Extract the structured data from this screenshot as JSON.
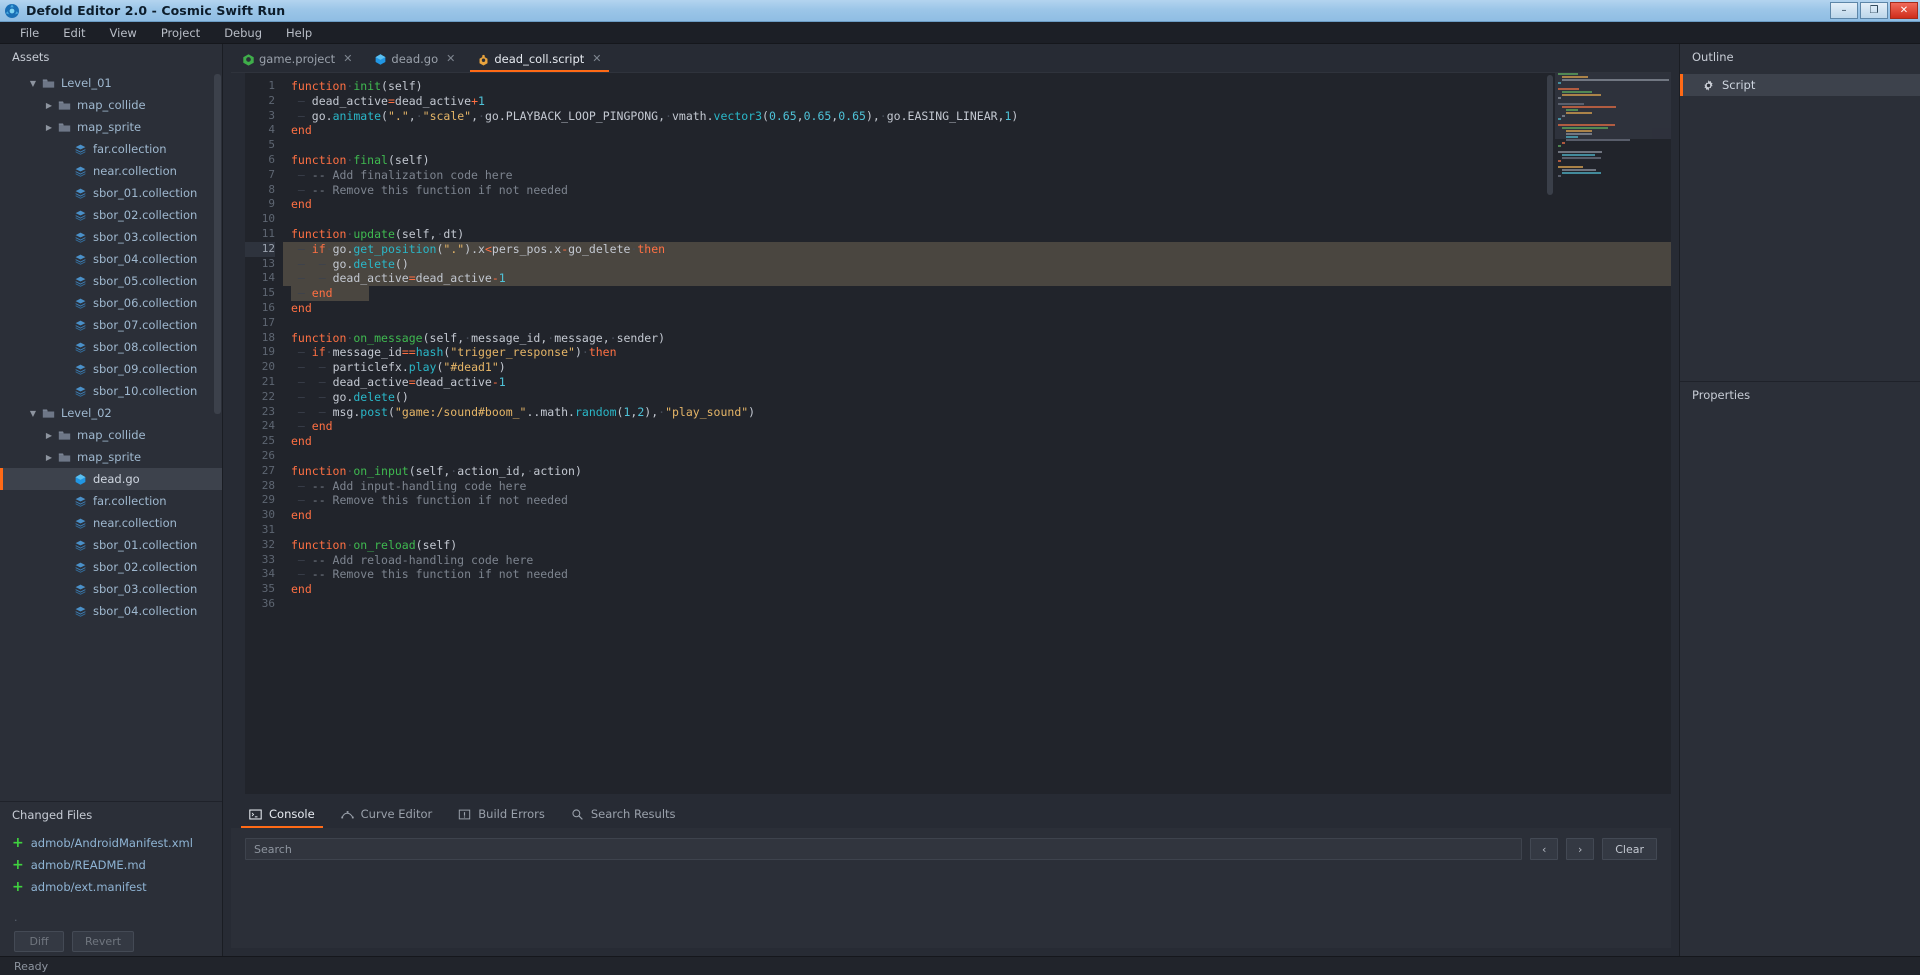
{
  "window": {
    "title": "Defold Editor 2.0 - Cosmic Swift Run",
    "app_icon": "defold-logo-icon",
    "minimize": "–",
    "maximize": "❐",
    "close": "✕"
  },
  "menubar": {
    "items": [
      "File",
      "Edit",
      "View",
      "Project",
      "Debug",
      "Help"
    ]
  },
  "assets": {
    "title": "Assets",
    "tree": [
      {
        "label": "Level_01",
        "depth": 1,
        "twisty": "▼",
        "icon": "folder-icon"
      },
      {
        "label": "map_collide",
        "depth": 2,
        "twisty": "▶",
        "icon": "folder-icon"
      },
      {
        "label": "map_sprite",
        "depth": 2,
        "twisty": "▶",
        "icon": "folder-icon"
      },
      {
        "label": "far.collection",
        "depth": 3,
        "twisty": "",
        "icon": "collection-icon"
      },
      {
        "label": "near.collection",
        "depth": 3,
        "twisty": "",
        "icon": "collection-icon"
      },
      {
        "label": "sbor_01.collection",
        "depth": 3,
        "twisty": "",
        "icon": "collection-icon"
      },
      {
        "label": "sbor_02.collection",
        "depth": 3,
        "twisty": "",
        "icon": "collection-icon"
      },
      {
        "label": "sbor_03.collection",
        "depth": 3,
        "twisty": "",
        "icon": "collection-icon"
      },
      {
        "label": "sbor_04.collection",
        "depth": 3,
        "twisty": "",
        "icon": "collection-icon"
      },
      {
        "label": "sbor_05.collection",
        "depth": 3,
        "twisty": "",
        "icon": "collection-icon"
      },
      {
        "label": "sbor_06.collection",
        "depth": 3,
        "twisty": "",
        "icon": "collection-icon"
      },
      {
        "label": "sbor_07.collection",
        "depth": 3,
        "twisty": "",
        "icon": "collection-icon"
      },
      {
        "label": "sbor_08.collection",
        "depth": 3,
        "twisty": "",
        "icon": "collection-icon"
      },
      {
        "label": "sbor_09.collection",
        "depth": 3,
        "twisty": "",
        "icon": "collection-icon"
      },
      {
        "label": "sbor_10.collection",
        "depth": 3,
        "twisty": "",
        "icon": "collection-icon"
      },
      {
        "label": "Level_02",
        "depth": 1,
        "twisty": "▼",
        "icon": "folder-icon"
      },
      {
        "label": "map_collide",
        "depth": 2,
        "twisty": "▶",
        "icon": "folder-icon"
      },
      {
        "label": "map_sprite",
        "depth": 2,
        "twisty": "▶",
        "icon": "folder-icon"
      },
      {
        "label": "dead.go",
        "depth": 3,
        "twisty": "",
        "icon": "gameobject-icon",
        "selected": true
      },
      {
        "label": "far.collection",
        "depth": 3,
        "twisty": "",
        "icon": "collection-icon"
      },
      {
        "label": "near.collection",
        "depth": 3,
        "twisty": "",
        "icon": "collection-icon"
      },
      {
        "label": "sbor_01.collection",
        "depth": 3,
        "twisty": "",
        "icon": "collection-icon"
      },
      {
        "label": "sbor_02.collection",
        "depth": 3,
        "twisty": "",
        "icon": "collection-icon"
      },
      {
        "label": "sbor_03.collection",
        "depth": 3,
        "twisty": "",
        "icon": "collection-icon"
      },
      {
        "label": "sbor_04.collection",
        "depth": 3,
        "twisty": "",
        "icon": "collection-icon"
      }
    ]
  },
  "changed_files": {
    "title": "Changed Files",
    "items": [
      {
        "status": "+",
        "path": "admob/AndroidManifest.xml"
      },
      {
        "status": "+",
        "path": "admob/README.md"
      },
      {
        "status": "+",
        "path": "admob/ext.manifest"
      }
    ],
    "more_indicator": "·",
    "diff_label": "Diff",
    "revert_label": "Revert"
  },
  "editor_tabs": [
    {
      "label": "game.project",
      "icon": "project-icon",
      "close": "✕",
      "active": false
    },
    {
      "label": "dead.go",
      "icon": "gameobject-icon",
      "close": "✕",
      "active": false
    },
    {
      "label": "dead_coll.script",
      "icon": "script-icon",
      "close": "✕",
      "active": true
    }
  ],
  "editor": {
    "first_line": 1,
    "last_line": 36,
    "cursor_line": 12,
    "selection_start_line": 12,
    "selection_end_line": 15,
    "lines": [
      {
        "n": 1,
        "t": "function init(self)"
      },
      {
        "n": 2,
        "t": "    dead_active=dead_active+1"
      },
      {
        "n": 3,
        "t": "    go.animate(\".\", \"scale\", go.PLAYBACK_LOOP_PINGPONG, vmath.vector3(0.65,0.65,0.65), go.EASING_LINEAR,1)"
      },
      {
        "n": 4,
        "t": "end"
      },
      {
        "n": 5,
        "t": ""
      },
      {
        "n": 6,
        "t": "function final(self)"
      },
      {
        "n": 7,
        "t": "    -- Add finalization code here"
      },
      {
        "n": 8,
        "t": "    -- Remove this function if not needed"
      },
      {
        "n": 9,
        "t": "end"
      },
      {
        "n": 10,
        "t": ""
      },
      {
        "n": 11,
        "t": "function update(self, dt)"
      },
      {
        "n": 12,
        "t": "    if go.get_position(\".\").x<pers_pos.x-go_delete then"
      },
      {
        "n": 13,
        "t": "        go.delete()"
      },
      {
        "n": 14,
        "t": "        dead_active=dead_active-1"
      },
      {
        "n": 15,
        "t": "    end"
      },
      {
        "n": 16,
        "t": "end"
      },
      {
        "n": 17,
        "t": ""
      },
      {
        "n": 18,
        "t": "function on_message(self, message_id, message, sender)"
      },
      {
        "n": 19,
        "t": "    if message_id==hash(\"trigger_response\") then"
      },
      {
        "n": 20,
        "t": "        particlefx.play(\"#dead1\")"
      },
      {
        "n": 21,
        "t": "        dead_active=dead_active-1"
      },
      {
        "n": 22,
        "t": "        go.delete()"
      },
      {
        "n": 23,
        "t": "        msg.post(\"game:/sound#boom_\"..math.random(1,2), \"play_sound\")"
      },
      {
        "n": 24,
        "t": "    end"
      },
      {
        "n": 25,
        "t": "end"
      },
      {
        "n": 26,
        "t": ""
      },
      {
        "n": 27,
        "t": "function on_input(self, action_id, action)"
      },
      {
        "n": 28,
        "t": "    -- Add input-handling code here"
      },
      {
        "n": 29,
        "t": "    -- Remove this function if not needed"
      },
      {
        "n": 30,
        "t": "end"
      },
      {
        "n": 31,
        "t": ""
      },
      {
        "n": 32,
        "t": "function on_reload(self)"
      },
      {
        "n": 33,
        "t": "    -- Add reload-handling code here"
      },
      {
        "n": 34,
        "t": "    -- Remove this function if not needed"
      },
      {
        "n": 35,
        "t": "end"
      },
      {
        "n": 36,
        "t": ""
      }
    ]
  },
  "bottom_panel": {
    "tabs": [
      {
        "label": "Console",
        "icon": "terminal-icon",
        "active": true
      },
      {
        "label": "Curve Editor",
        "icon": "curve-icon",
        "active": false
      },
      {
        "label": "Build Errors",
        "icon": "warning-box-icon",
        "active": false
      },
      {
        "label": "Search Results",
        "icon": "search-icon",
        "active": false
      }
    ],
    "search_placeholder": "Search",
    "search_value": "",
    "prev_label": "‹",
    "next_label": "›",
    "clear_label": "Clear"
  },
  "outline": {
    "title": "Outline",
    "items": [
      {
        "label": "Script",
        "icon": "gear-icon",
        "selected": true
      }
    ]
  },
  "properties": {
    "title": "Properties"
  },
  "statusbar": {
    "text": "Ready"
  },
  "colors": {
    "accent": "#ff6a16",
    "keyword": "#ff7043",
    "function": "#3fb950",
    "string": "#e5b567",
    "number": "#4fc3d9",
    "method": "#2ab7c8",
    "comment": "#7d848f",
    "selection": "#4a4640",
    "panel_bg": "#2b2f38",
    "editor_bg": "#21242b",
    "added_file": "#3fd23f"
  }
}
